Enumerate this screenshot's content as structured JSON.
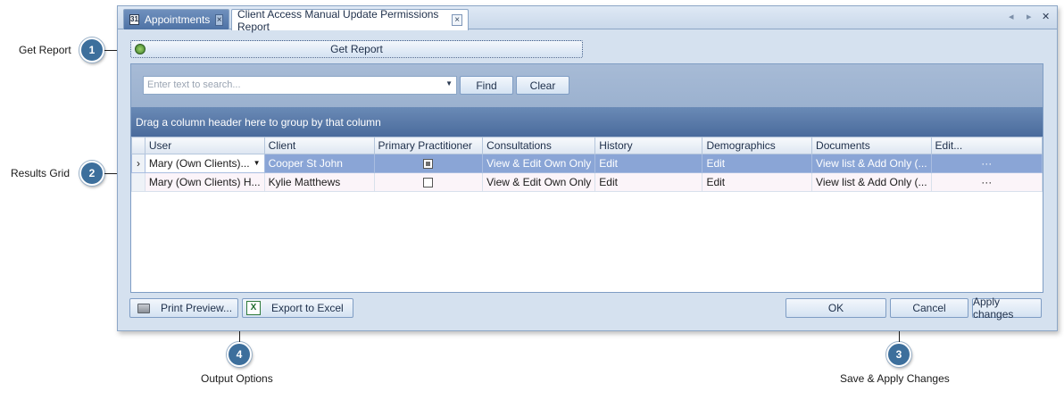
{
  "callouts": [
    {
      "number": "1",
      "label": "Get Report"
    },
    {
      "number": "2",
      "label": "Results Grid"
    },
    {
      "number": "3",
      "label": "Save & Apply Changes"
    },
    {
      "number": "4",
      "label": "Output Options"
    }
  ],
  "tabs": [
    {
      "label": "Appointments",
      "icon_text": "31",
      "close": "×"
    },
    {
      "label": "Client Access Manual Update Permissions Report",
      "close": "×"
    }
  ],
  "tab_nav": {
    "prev": "◂",
    "next": "▸",
    "close": "✕"
  },
  "get_report": {
    "label": "Get Report"
  },
  "search": {
    "placeholder": "Enter text to search...",
    "find_label": "Find",
    "clear_label": "Clear"
  },
  "group_panel": {
    "text": "Drag a column header here to group by that column"
  },
  "grid": {
    "columns": [
      "User",
      "Client",
      "Primary Practitioner",
      "Consultations",
      "History",
      "Demographics",
      "Documents",
      "Edit..."
    ],
    "rows": [
      {
        "indicator": "›",
        "user": "Mary (Own Clients)...",
        "client": "Cooper St John",
        "primary_practitioner": true,
        "consultations": "View & Edit Own Only",
        "history": "Edit",
        "demographics": "Edit",
        "documents": "View list & Add Only (...",
        "edit": "···"
      },
      {
        "indicator": "",
        "user": "Mary (Own Clients) H...",
        "client": "Kylie Matthews",
        "primary_practitioner": false,
        "consultations": "View & Edit Own Only",
        "history": "Edit",
        "demographics": "Edit",
        "documents": "View list & Add Only (...",
        "edit": "···"
      }
    ]
  },
  "footer": {
    "print_preview": "Print Preview...",
    "export_excel": "Export to Excel",
    "ok": "OK",
    "cancel": "Cancel",
    "apply": "Apply changes"
  },
  "colors": {
    "badge": "#3d6f9c",
    "selected_row": "#8aa5d6",
    "group_bar": "#5677a8"
  }
}
